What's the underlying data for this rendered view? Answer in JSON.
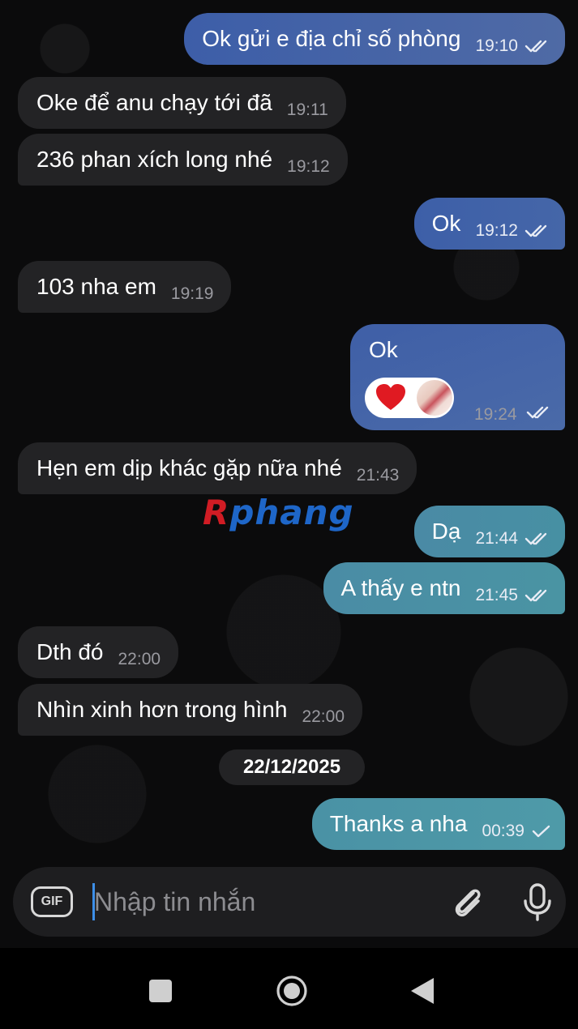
{
  "colors": {
    "incoming_bubble": "#232325",
    "outgoing_gradient_start": "#3d5ea8",
    "outgoing_gradient_end": "#4a90a4",
    "input_bar": "#1e1e20",
    "caret": "#3d8fe8"
  },
  "messages": [
    {
      "dir": "out",
      "text": "Ok gửi e địa chỉ số phòng",
      "time": "19:10",
      "status": "read"
    },
    {
      "dir": "in",
      "text": "Oke để anu chạy tới đã",
      "time": "19:11"
    },
    {
      "dir": "in",
      "text": "236 phan xích long nhé",
      "time": "19:12"
    },
    {
      "dir": "out",
      "text": "Ok",
      "time": "19:12",
      "status": "read"
    },
    {
      "dir": "in",
      "text": "103 nha em",
      "time": "19:19"
    },
    {
      "dir": "out",
      "text": "Ok",
      "time": "19:24",
      "status": "read",
      "reactions": [
        "heart-emoji",
        "user-reaction-avatar"
      ]
    },
    {
      "dir": "in",
      "text": "Hẹn em dịp khác gặp nữa nhé",
      "time": "21:43"
    },
    {
      "dir": "out",
      "text": "Dạ",
      "time": "21:44",
      "status": "read"
    },
    {
      "dir": "out",
      "text": "A thấy e ntn",
      "time": "21:45",
      "status": "read"
    },
    {
      "dir": "in",
      "text": "Dth đó",
      "time": "22:00"
    },
    {
      "dir": "in",
      "text": "Nhìn xinh hơn trong hình",
      "time": "22:00"
    },
    {
      "dir": "out",
      "text": "Thanks a nha",
      "time": "00:39",
      "status": "sent"
    }
  ],
  "date_separator": "22/12/2025",
  "watermark": {
    "part1": "R",
    "part2": "phang"
  },
  "composer": {
    "gif_label": "GIF",
    "placeholder": "Nhập tin nhắn",
    "icons": [
      "gif-icon",
      "paperclip-icon",
      "microphone-icon"
    ]
  },
  "navigation": {
    "icons": [
      "recents-square-icon",
      "home-circle-icon",
      "back-triangle-icon"
    ]
  }
}
